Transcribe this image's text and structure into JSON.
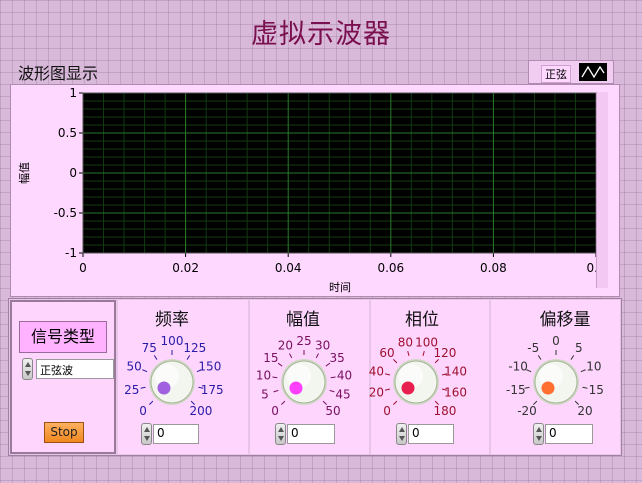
{
  "title": "虚拟示波器",
  "graph": {
    "label": "波形图显示",
    "legend": {
      "label": "正弦"
    },
    "x_axis_label": "时间",
    "y_axis_label": "幅值"
  },
  "chart_data": {
    "type": "line",
    "title": "",
    "xlabel": "时间",
    "ylabel": "幅值",
    "xlim": [
      0,
      0.1
    ],
    "ylim": [
      -1,
      1
    ],
    "x_ticks": [
      "0",
      "0.02",
      "0.04",
      "0.06",
      "0.08",
      "0.1"
    ],
    "y_ticks": [
      "1",
      "0.5",
      "0",
      "-0.5",
      "-1"
    ],
    "series": [
      {
        "values": []
      }
    ],
    "grid": true,
    "colors": {
      "plot_bg": "#000000",
      "major_grid": "#2a7a2a",
      "minor_grid": "#123a12"
    }
  },
  "signal_type": {
    "label": "信号类型",
    "value": "正弦波"
  },
  "stop_label": "Stop",
  "knobs": [
    {
      "id": "freq",
      "title": "频率",
      "value": "0",
      "ticks": [
        "0",
        "25",
        "50",
        "75",
        "100",
        "125",
        "150",
        "175",
        "200"
      ],
      "tick_color": "#2a1aa8",
      "indicator_color": "#a060e0"
    },
    {
      "id": "amp",
      "title": "幅值",
      "value": "0",
      "ticks": [
        "0",
        "5",
        "10",
        "15",
        "20",
        "25",
        "30",
        "35",
        "40",
        "45",
        "50"
      ],
      "tick_color": "#7a1060",
      "indicator_color": "#ff40ff"
    },
    {
      "id": "phase",
      "title": "相位",
      "value": "0",
      "ticks": [
        "0",
        "20",
        "40",
        "60",
        "80",
        "100",
        "120",
        "140",
        "160",
        "180"
      ],
      "tick_color": "#a01030",
      "indicator_color": "#e82050"
    },
    {
      "id": "offset",
      "title": "偏移量",
      "value": "0",
      "ticks": [
        "-20",
        "-15",
        "-10",
        "-5",
        "0",
        "5",
        "10",
        "15",
        "20"
      ],
      "tick_color": "#333333",
      "indicator_color": "#ff7030"
    }
  ]
}
